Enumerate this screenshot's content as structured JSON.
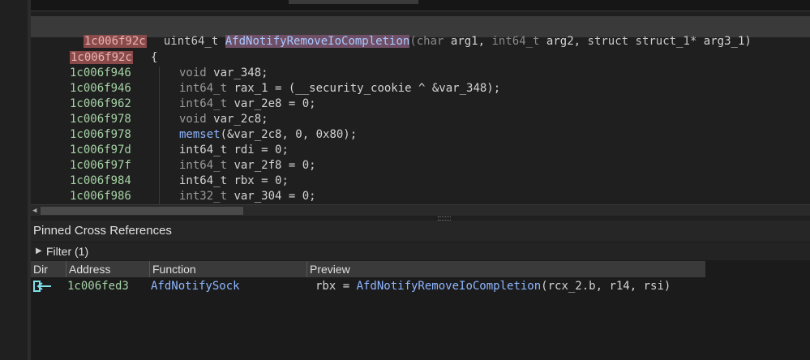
{
  "signature": {
    "address": "1c006f92c",
    "return_type": "uint64_t",
    "function_name": "AfdNotifyRemoveIoCompletion",
    "open_paren": "(",
    "p1_type": "char",
    "p1_name": " arg1, ",
    "p2_type": "int64_t",
    "p2_name": " arg2, ",
    "p3_type": "struct struct_1*",
    "p3_name": " arg3_1)"
  },
  "code_lines": [
    {
      "address": "1c006f92c",
      "text": "{"
    },
    {
      "address": "1c006f946",
      "type": "void",
      "rest": " var_348;"
    },
    {
      "address": "1c006f946",
      "type": "int64_t",
      "rest": " rax_1 = (__security_cookie ^ &var_348);"
    },
    {
      "address": "1c006f962",
      "type": "int64_t",
      "rest": " var_2e8 = 0;"
    },
    {
      "address": "1c006f978",
      "type": "void",
      "rest": " var_2c8;"
    },
    {
      "address": "1c006f978",
      "fn": "memset",
      "rest": "(&var_2c8, 0, 0x80);"
    },
    {
      "address": "1c006f97d",
      "type": "int64_t",
      "rest": " rdi = 0;"
    },
    {
      "address": "1c006f97f",
      "type": "int64_t",
      "rest": " var_2f8 = 0;"
    },
    {
      "address": "1c006f984",
      "type": "int64_t",
      "rest": " rbx = 0;"
    },
    {
      "address": "1c006f986",
      "type": "int32_t",
      "rest": " var_304 = 0;"
    }
  ],
  "xrefs_panel": {
    "title": "Pinned Cross References",
    "filter_label": "Filter (1)",
    "columns": [
      "Dir",
      "Address",
      "Function",
      "Preview"
    ],
    "rows": [
      {
        "direction_icon": "incoming-arrow-icon",
        "address": "1c006fed3",
        "function": "AfdNotifySock",
        "preview_prefix": "rbx = ",
        "preview_fn": "AfdNotifyRemoveIoCompletion",
        "preview_suffix": "(rcx_2.b, r14, rsi)"
      }
    ]
  },
  "colors": {
    "address_green": "#a6d3a6",
    "highlight_red": "#8a4a4a",
    "function_blue": "#8fb6ff",
    "selection_purple": "#6e4f66",
    "arrow_cyan": "#7ee0e8"
  }
}
